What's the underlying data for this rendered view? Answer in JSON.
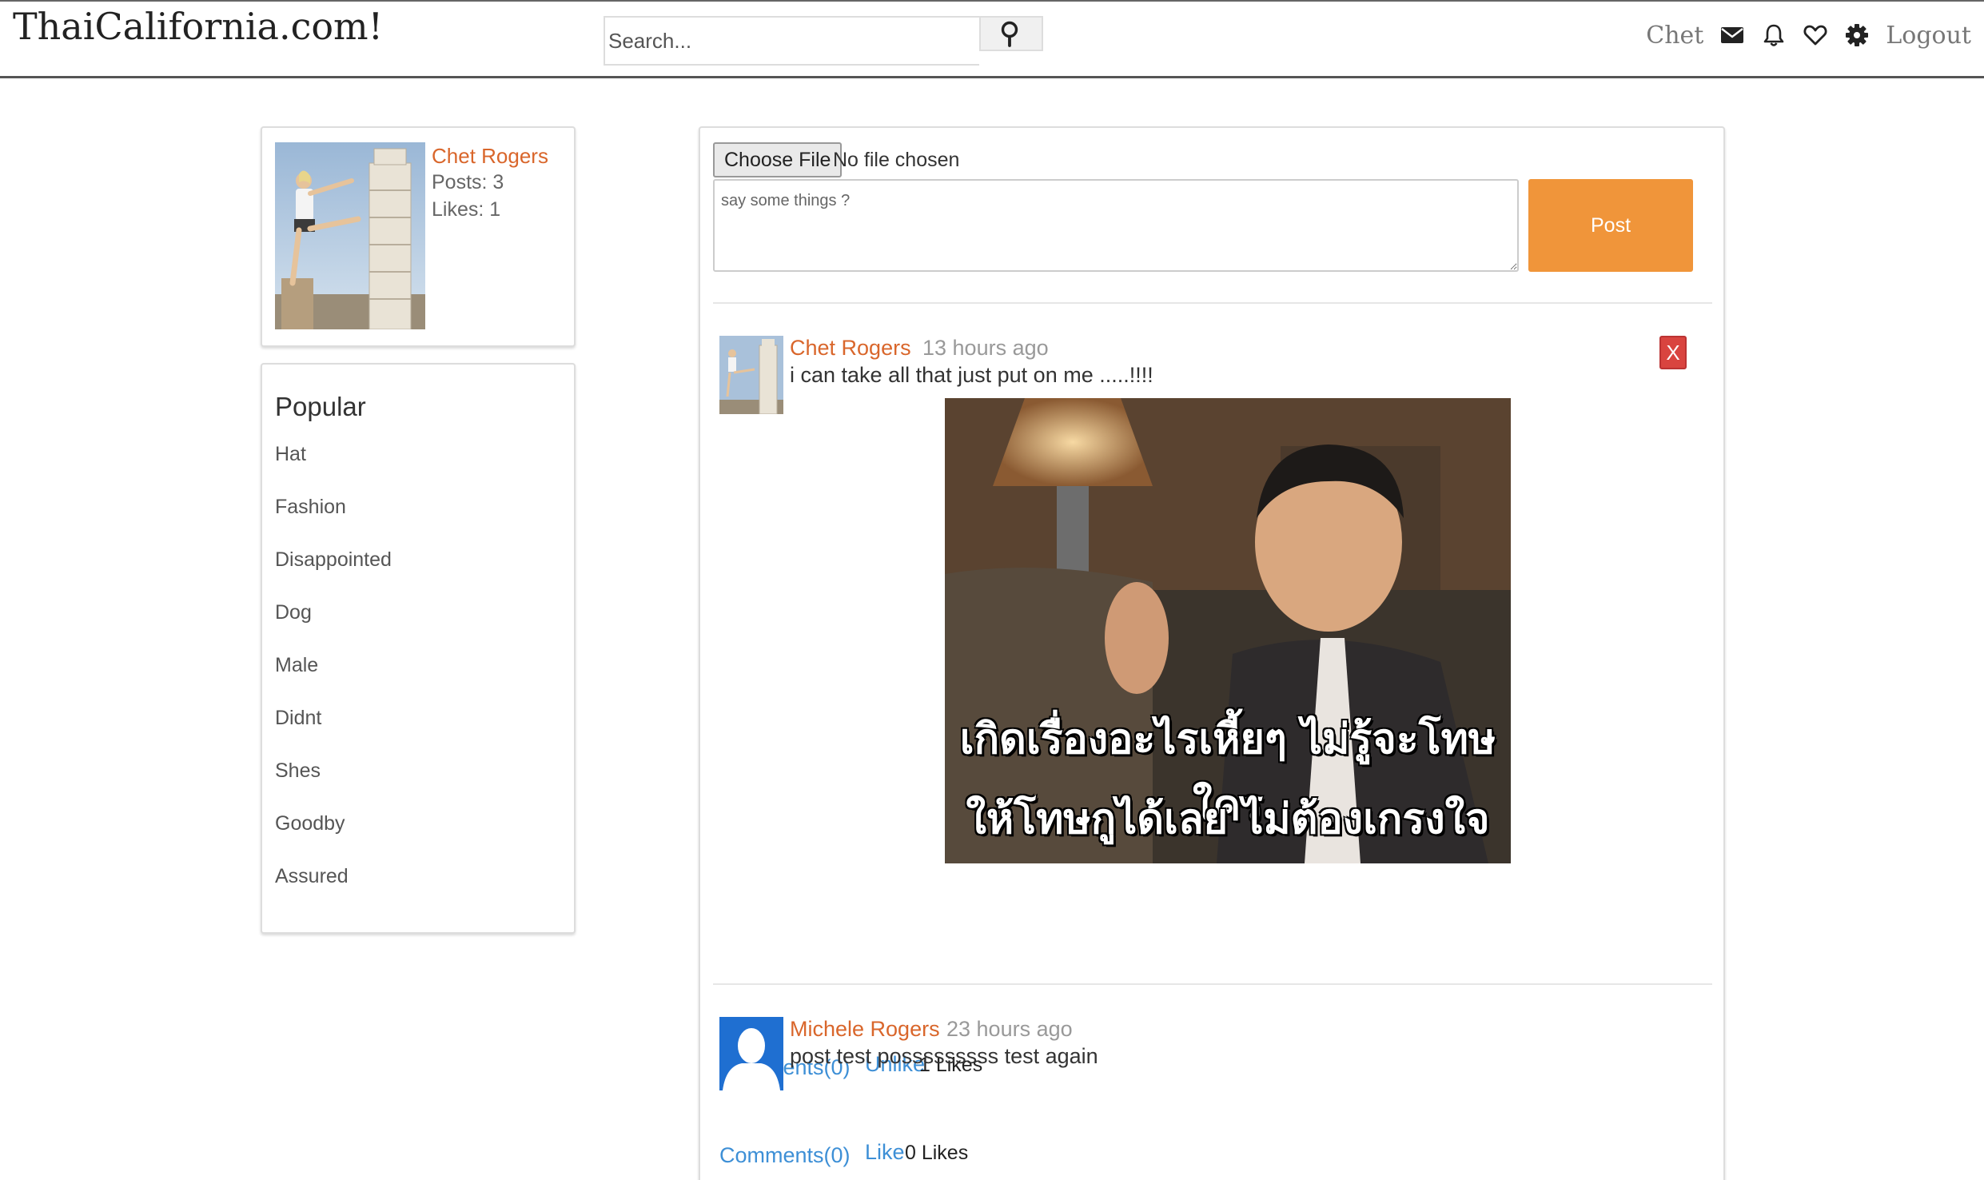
{
  "header": {
    "logo": "ThaiCalifornia.com!",
    "search_placeholder": "Search...",
    "user_name": "Chet",
    "logout": "Logout"
  },
  "icons": {
    "search": "search-icon",
    "messages": "envelope-icon",
    "notifications": "bell-icon",
    "likes": "heart-icon",
    "settings": "gear-icon"
  },
  "profile": {
    "name": "Chet Rogers",
    "posts": "Posts: 3",
    "likes": "Likes: 1"
  },
  "popular": {
    "title": "Popular",
    "items": [
      "Hat",
      "Fashion",
      "Disappointed",
      "Dog",
      "Male",
      "Didnt",
      "Shes",
      "Goodby",
      "Assured"
    ]
  },
  "composer": {
    "file_button": "Choose File",
    "file_status": "No file chosen",
    "placeholder": "say some things ?",
    "post_button": "Post"
  },
  "posts": [
    {
      "author": "Chet Rogers",
      "time": "13 hours ago",
      "body": "i can take all that just put on me .....!!!!",
      "delete_label": "X",
      "image_caption_line1": "เกิดเรื่องอะไรเหี้ยๆ ไม่รู้จะโทษใคร",
      "image_caption_line2": "ให้โทษกูได้เลย ไม่ต้องเกรงใจ",
      "comments": "Comments(0)",
      "like_action": "Unlike",
      "likes": "1 Likes"
    },
    {
      "author": "Michele Rogers",
      "time": "23 hours ago",
      "body": "post test posssssssss test again",
      "comments": "Comments(0)",
      "like_action": "Like",
      "likes": "0 Likes"
    }
  ],
  "colors": {
    "accent_orange": "#f0953a",
    "author_orange": "#d9662b",
    "link_blue": "#3d8fd6",
    "delete_red": "#d9443f"
  }
}
